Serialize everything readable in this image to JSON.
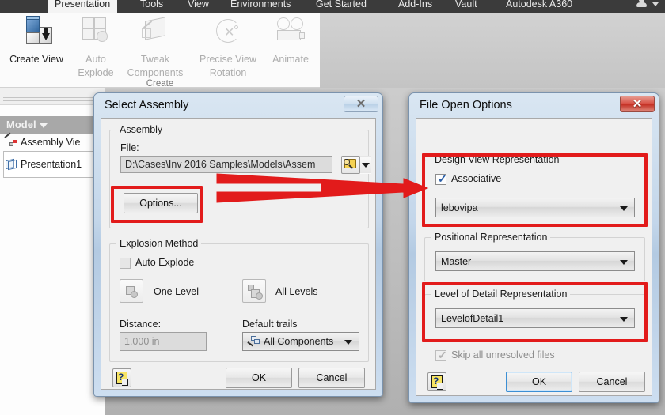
{
  "ribbon": {
    "tabs": [
      {
        "label": "Presentation",
        "active": true
      },
      {
        "label": "Tools",
        "active": false
      },
      {
        "label": "View",
        "active": false
      },
      {
        "label": "Environments",
        "active": false
      },
      {
        "label": "Get Started",
        "active": false
      },
      {
        "label": "Add-Ins",
        "active": false
      },
      {
        "label": "Vault",
        "active": false
      },
      {
        "label": "Autodesk A360",
        "active": false
      }
    ],
    "panel_title": "Create",
    "commands": [
      {
        "label": "Create View",
        "label2": "",
        "enabled": true,
        "icon": "create-view-icon"
      },
      {
        "label": "Auto",
        "label2": "Explode",
        "enabled": false,
        "icon": "auto-explode-icon"
      },
      {
        "label": "Tweak",
        "label2": "Components",
        "enabled": false,
        "icon": "tweak-components-icon"
      },
      {
        "label": "Precise View",
        "label2": "Rotation",
        "enabled": false,
        "icon": "precise-view-rotation-icon"
      },
      {
        "label": "Animate",
        "label2": "",
        "enabled": false,
        "icon": "animate-icon"
      }
    ]
  },
  "browser": {
    "header": "Model",
    "tree": [
      {
        "label": "Assembly Vie",
        "icon": "assembly-view-icon"
      },
      {
        "label": "Presentation1",
        "icon": "presentation-icon"
      }
    ]
  },
  "select_assembly": {
    "title": "Select Assembly",
    "close_label": "✕",
    "group_assembly": "Assembly",
    "file_label": "File:",
    "file_value": "D:\\Cases\\Inv 2016 Samples\\Models\\Assem",
    "browse_icon": "browse-folder-icon",
    "dropdown_icon": "chevron-down-icon",
    "options_button": "Options...",
    "group_explosion": "Explosion Method",
    "auto_explode_label": "Auto Explode",
    "auto_explode_checked": false,
    "one_level_label": "One Level",
    "all_levels_label": "All Levels",
    "distance_label": "Distance:",
    "distance_value": "1.000 in",
    "default_trails_label": "Default trails",
    "default_trails_value": "All Components",
    "help_icon": "help-icon",
    "ok_label": "OK",
    "cancel_label": "Cancel"
  },
  "file_open_options": {
    "title": "File Open Options",
    "close_label": "✕",
    "design_view_group": "Design View Representation",
    "associative_label": "Associative",
    "associative_checked": true,
    "design_view_value": "lebovipa",
    "positional_group": "Positional Representation",
    "positional_value": "Master",
    "lod_group": "Level of Detail Representation",
    "lod_value": "LevelofDetail1",
    "skip_label": "Skip all unresolved files",
    "skip_checked": true,
    "skip_disabled": true,
    "help_icon": "help-icon",
    "ok_label": "OK",
    "cancel_label": "Cancel"
  },
  "annotations": {
    "highlight_color": "#e21b1b",
    "boxes": [
      {
        "name": "options-button-highlight"
      },
      {
        "name": "design-view-representation-highlight"
      },
      {
        "name": "level-of-detail-highlight"
      }
    ],
    "arrow": {
      "name": "options-to-design-view-arrow",
      "from": "Options...",
      "to": "Design View Representation"
    }
  }
}
